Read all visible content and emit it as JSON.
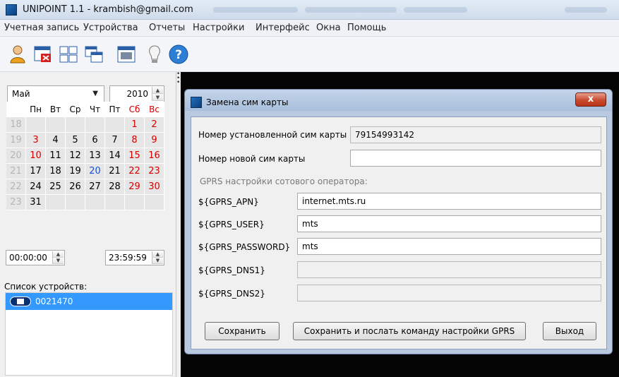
{
  "window": {
    "title": "UNIPOINT 1.1 - krambish@gmail.com"
  },
  "menu": [
    "Учетная запись",
    "Устройства",
    "Отчеты",
    "Настройки",
    "Интерфейс",
    "Окна",
    "Помощь"
  ],
  "toolbar": {
    "icons": [
      "user-icon",
      "delete-window-icon",
      "grid-layout-icon",
      "cascade-windows-icon",
      "calendar-window-icon",
      "lightbulb-icon",
      "help-icon"
    ]
  },
  "calendar": {
    "month": "Май",
    "year": "2010",
    "weekdays": [
      "Пн",
      "Вт",
      "Ср",
      "Чт",
      "Пт",
      "Сб",
      "Вс"
    ],
    "weeks": [
      {
        "num": "18",
        "days": [
          "",
          "",
          "",
          "",
          "",
          "1",
          "2"
        ]
      },
      {
        "num": "19",
        "days": [
          "3",
          "4",
          "5",
          "6",
          "7",
          "8",
          "9"
        ]
      },
      {
        "num": "20",
        "days": [
          "10",
          "11",
          "12",
          "13",
          "14",
          "15",
          "16"
        ]
      },
      {
        "num": "21",
        "days": [
          "17",
          "18",
          "19",
          "20",
          "21",
          "22",
          "23"
        ]
      },
      {
        "num": "22",
        "days": [
          "24",
          "25",
          "26",
          "27",
          "28",
          "29",
          "30"
        ]
      },
      {
        "num": "23",
        "days": [
          "31",
          "",
          "",
          "",
          "",
          "",
          ""
        ]
      }
    ],
    "holiday_color": "#d40000",
    "selected_color": "#1a4fd6",
    "time_from": "00:00:00",
    "time_to": "23:59:59"
  },
  "devices": {
    "label": "Список устройств:",
    "items": [
      "0021470"
    ],
    "selected_color": "#3399ff"
  },
  "dialog": {
    "title": "Замена сим карты",
    "current_sim_label": "Номер установленной сим карты",
    "current_sim_value": "79154993142",
    "new_sim_label": "Номер новой сим карты",
    "new_sim_value": "",
    "gprs_section_label": "GPRS настройки сотового оператора:",
    "fields": [
      {
        "label": "${GPRS_APN}",
        "value": "internet.mts.ru",
        "enabled": true
      },
      {
        "label": "${GPRS_USER}",
        "value": "mts",
        "enabled": true
      },
      {
        "label": "${GPRS_PASSWORD}",
        "value": "mts",
        "enabled": true
      },
      {
        "label": "${GPRS_DNS1}",
        "value": "",
        "enabled": false
      },
      {
        "label": "${GPRS_DNS2}",
        "value": "",
        "enabled": false
      }
    ],
    "buttons": {
      "save": "Сохранить",
      "save_send": "Сохранить и послать команду настройки GPRS",
      "exit": "Выход"
    },
    "close_glyph": "x"
  }
}
